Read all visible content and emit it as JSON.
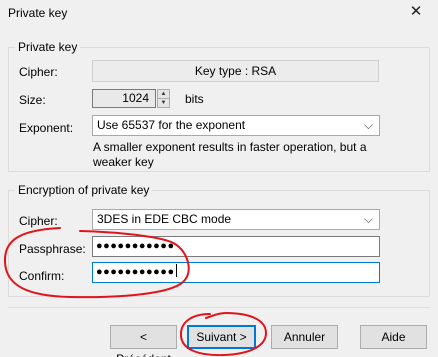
{
  "window": {
    "title": "Private key"
  },
  "private_key_group": {
    "label": "Private key",
    "cipher_label": "Cipher:",
    "cipher_value": "Key type : RSA",
    "size_label": "Size:",
    "size_value": "1024",
    "size_unit": "bits",
    "exponent_label": "Exponent:",
    "exponent_value": "Use 65537 for the exponent",
    "help_text": "A smaller exponent results in faster operation, but a weaker key"
  },
  "encryption_group": {
    "label": "Encryption of private key",
    "cipher_label": "Cipher:",
    "cipher_value": "3DES in EDE CBC mode",
    "passphrase_label": "Passphrase:",
    "passphrase_value": "●●●●●●●●●●●",
    "confirm_label": "Confirm:",
    "confirm_value": "●●●●●●●●●●●"
  },
  "buttons": {
    "back": "< Précédent",
    "next": "Suivant >",
    "cancel": "Annuler",
    "help": "Aide"
  },
  "colors": {
    "annotation": "#e0151b",
    "focus": "#0078d7"
  },
  "icons": {
    "close": "close-icon",
    "combo_arrow": "chevron-down-icon",
    "spin_up": "spin-up-icon",
    "spin_down": "spin-down-icon"
  }
}
